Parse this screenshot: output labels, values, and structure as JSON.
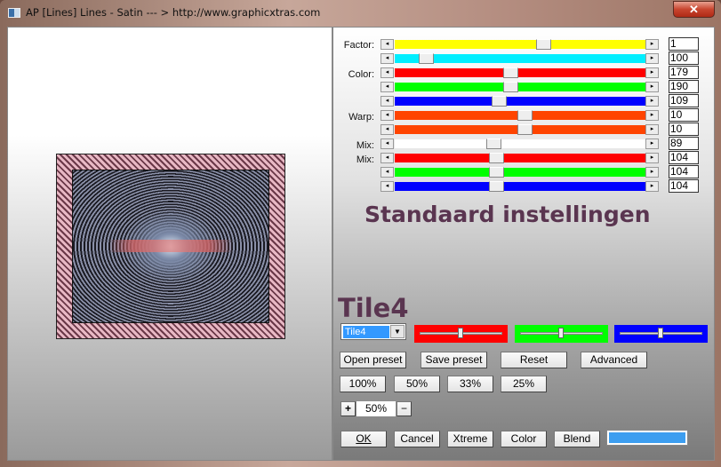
{
  "window": {
    "title": "AP [Lines]  Lines - Satin    --- > http://www.graphicxtras.com",
    "close_icon": "close-icon"
  },
  "labels": {
    "factor": "Factor:",
    "color": "Color:",
    "warp": "Warp:",
    "mix1": "Mix:",
    "mix2": "Mix:"
  },
  "sliders": [
    {
      "color": "#ffff00",
      "position": 0.6,
      "value": "1"
    },
    {
      "color": "#00eeff",
      "position": 0.1,
      "value": "100"
    },
    {
      "color": "#ff0000",
      "position": 0.46,
      "value": "179"
    },
    {
      "color": "#00ff00",
      "position": 0.46,
      "value": "190"
    },
    {
      "color": "#0000ff",
      "position": 0.41,
      "value": "109"
    },
    {
      "color": "#ff4400",
      "position": 0.52,
      "value": "10"
    },
    {
      "color": "#ff4400",
      "position": 0.52,
      "value": "10"
    },
    {
      "color": "#ffffff",
      "position": 0.39,
      "value": "89"
    },
    {
      "color": "#ff0000",
      "position": 0.4,
      "value": "104"
    },
    {
      "color": "#00ff00",
      "position": 0.4,
      "value": "104"
    },
    {
      "color": "#0000ff",
      "position": 0.4,
      "value": "104"
    }
  ],
  "heading": "Standaard instellingen",
  "preset_title": "Tile4",
  "preset_select": "Tile4",
  "swatch_sliders": [
    {
      "color": "#ff0000",
      "position": 0.5
    },
    {
      "color": "#00ff00",
      "position": 0.5
    },
    {
      "color": "#0000ff",
      "position": 0.5
    }
  ],
  "buttons": {
    "open_preset": "Open preset",
    "save_preset": "Save preset",
    "reset": "Reset",
    "advanced": "Advanced",
    "z100": "100%",
    "z50": "50%",
    "z33": "33%",
    "z25": "25%",
    "plus": "+",
    "minus": "−",
    "ok": "OK",
    "cancel": "Cancel",
    "xtreme": "Xtreme",
    "color": "Color",
    "blend": "Blend"
  },
  "zoom_value": "50%",
  "blend_color": "#3d9ef0"
}
